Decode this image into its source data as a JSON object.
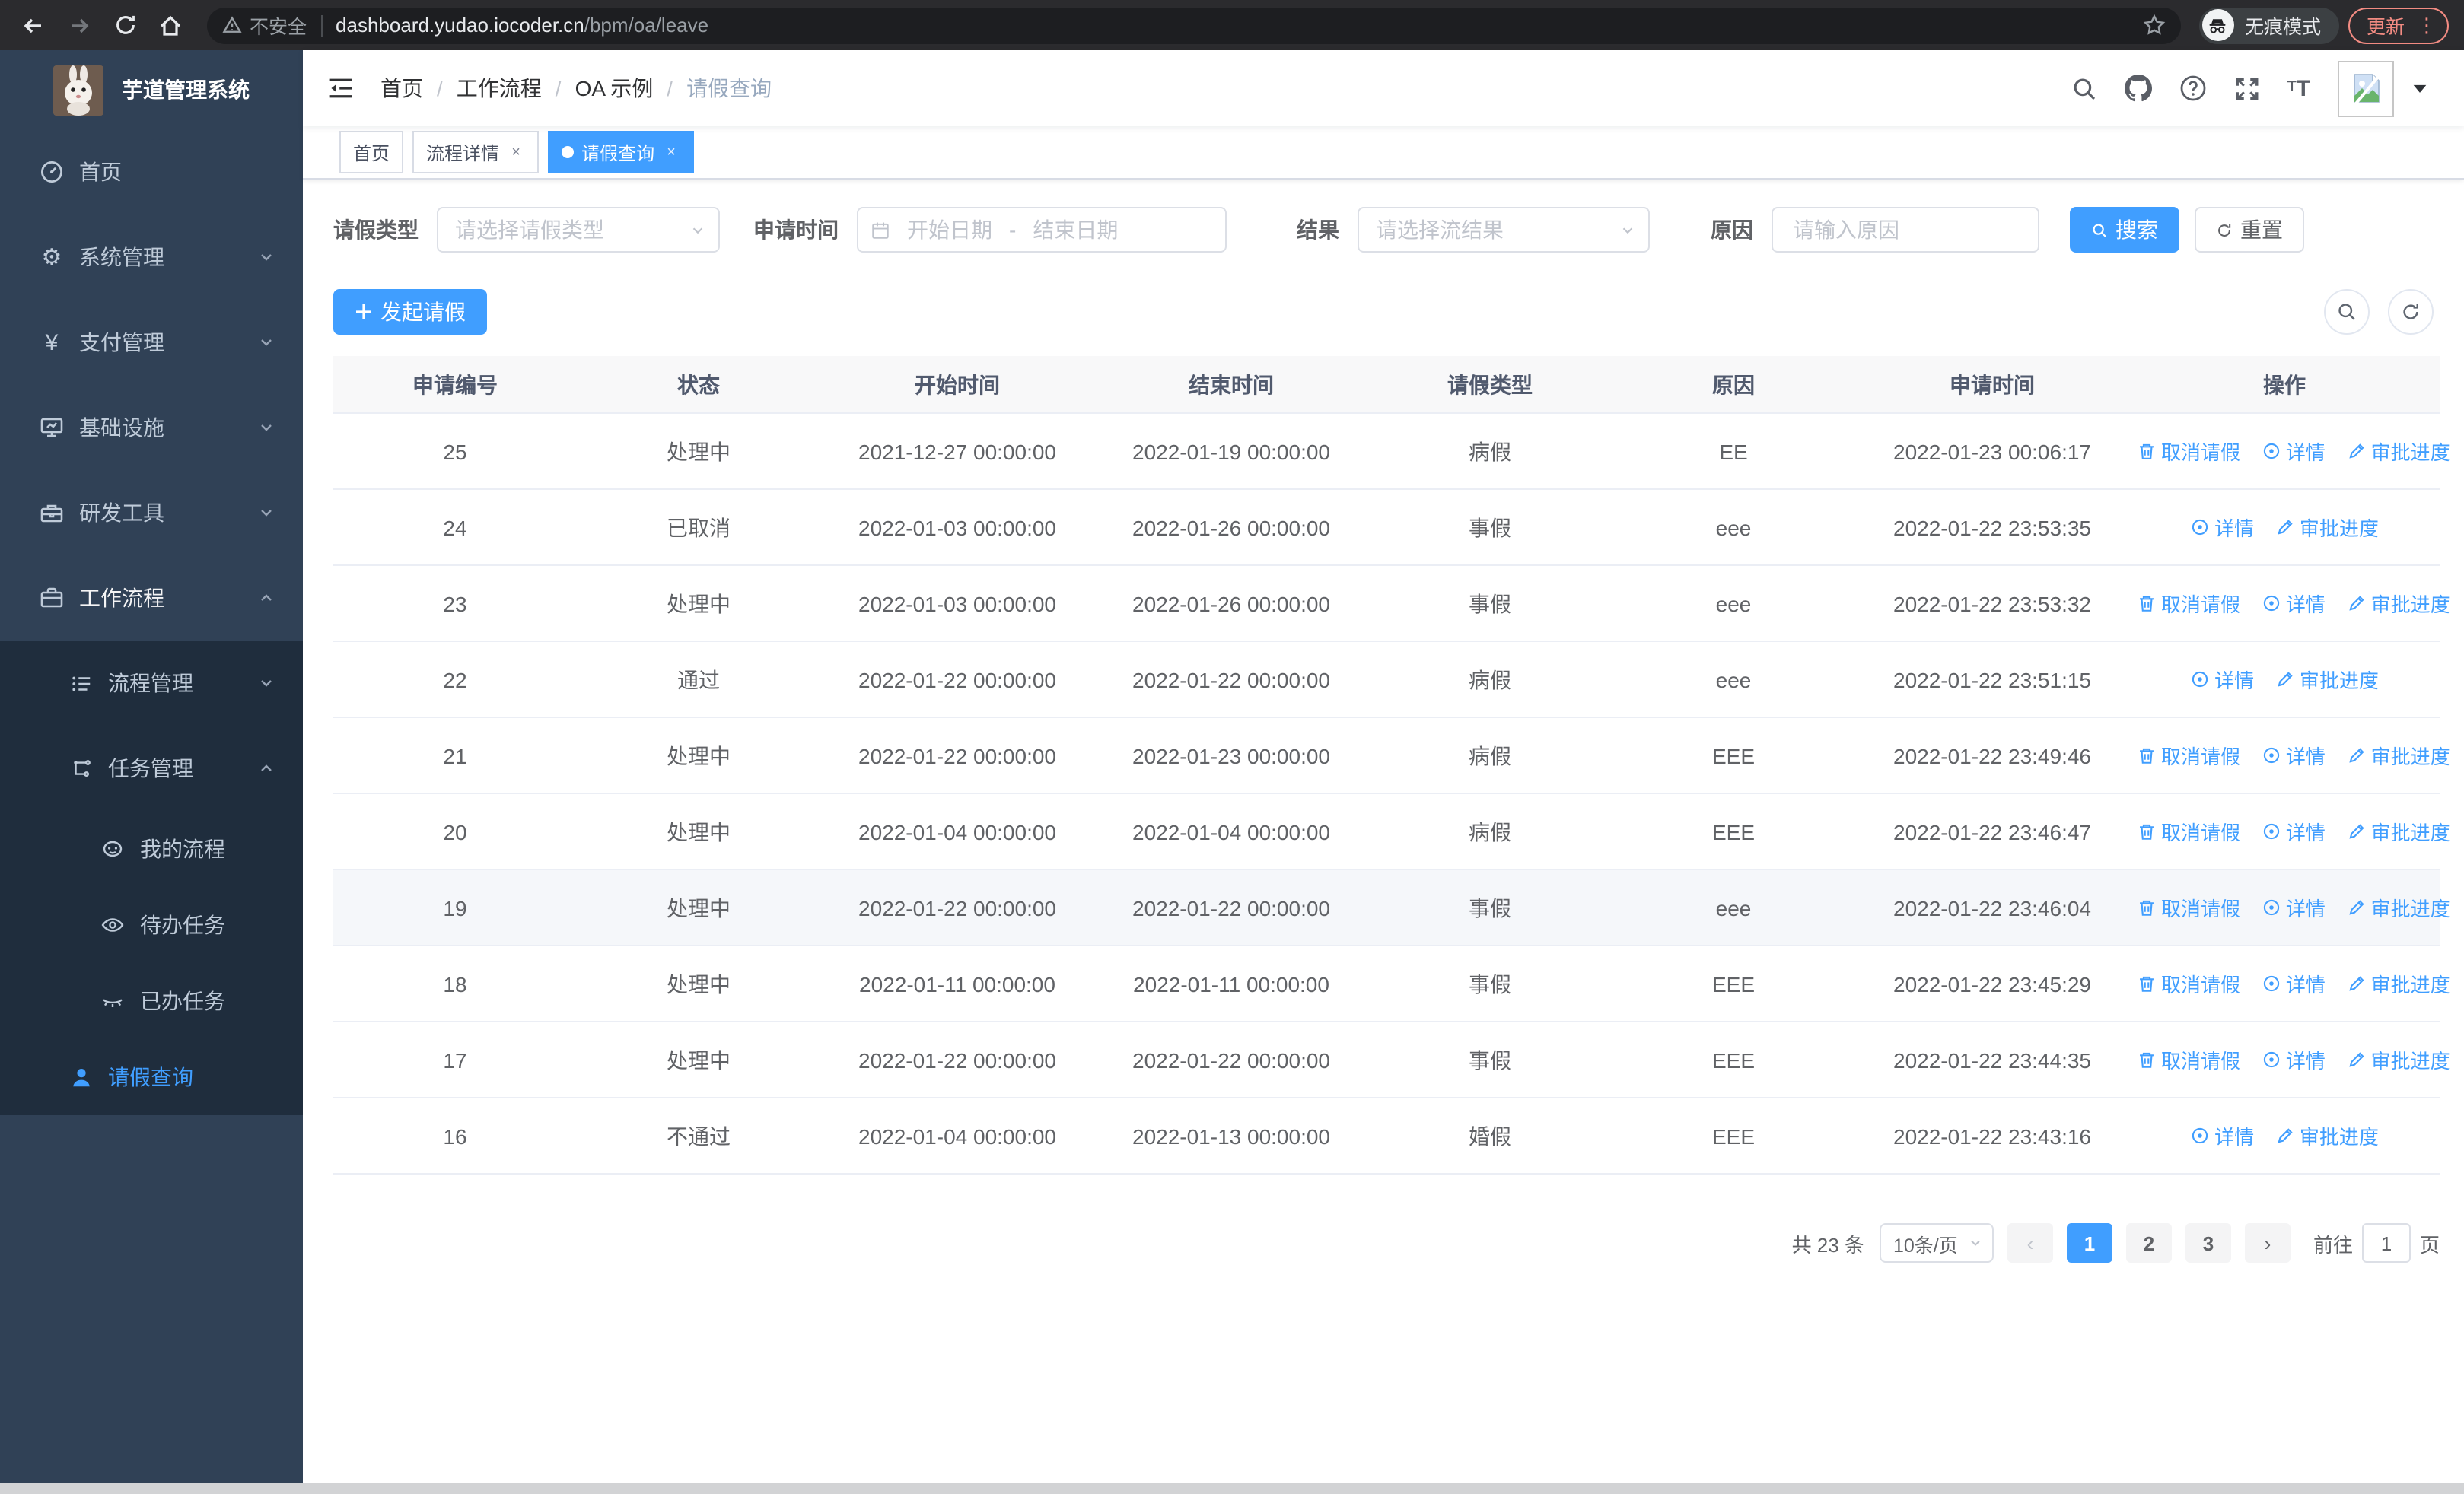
{
  "browser": {
    "security_label": "不安全",
    "url_host": "dashboard.yudao.iocoder.cn",
    "url_path": "/bpm/oa/leave",
    "incognito_label": "无痕模式",
    "update_label": "更新",
    "menu_dots": "⋮"
  },
  "sidebar": {
    "title": "芋道管理系统",
    "items": [
      {
        "label": "首页"
      },
      {
        "label": "系统管理"
      },
      {
        "label": "支付管理"
      },
      {
        "label": "基础设施"
      },
      {
        "label": "研发工具"
      },
      {
        "label": "工作流程"
      },
      {
        "label": "流程管理"
      },
      {
        "label": "任务管理"
      },
      {
        "label": "我的流程"
      },
      {
        "label": "待办任务"
      },
      {
        "label": "已办任务"
      },
      {
        "label": "请假查询"
      }
    ]
  },
  "icons": {
    "gear": "⚙",
    "yen": "¥",
    "question": "?",
    "text_size_big": "T",
    "text_size_small": "T"
  },
  "breadcrumb": [
    "首页",
    "工作流程",
    "OA 示例",
    "请假查询"
  ],
  "tabs": [
    {
      "label": "首页",
      "close": "×"
    },
    {
      "label": "流程详情",
      "close": "×"
    },
    {
      "label": "请假查询",
      "close": "×"
    }
  ],
  "filters": {
    "type_label": "请假类型",
    "type_placeholder": "请选择请假类型",
    "time_label": "申请时间",
    "time_start_placeholder": "开始日期",
    "time_separator": "-",
    "time_end_placeholder": "结束日期",
    "result_label": "结果",
    "result_placeholder": "请选择流结果",
    "reason_label": "原因",
    "reason_placeholder": "请输入原因",
    "search_label": "搜索",
    "reset_label": "重置"
  },
  "toolbar": {
    "create_label": "发起请假"
  },
  "table": {
    "columns": [
      "申请编号",
      "状态",
      "开始时间",
      "结束时间",
      "请假类型",
      "原因",
      "申请时间",
      "操作"
    ],
    "action_labels": {
      "cancel": "取消请假",
      "detail": "详情",
      "progress": "审批进度"
    },
    "rows": [
      {
        "id": "25",
        "status": "处理中",
        "start": "2021-12-27 00:00:00",
        "end": "2022-01-19 00:00:00",
        "type": "病假",
        "reason": "EE",
        "applied": "2022-01-23 00:06:17",
        "cancellable": true,
        "highlighted": false
      },
      {
        "id": "24",
        "status": "已取消",
        "start": "2022-01-03 00:00:00",
        "end": "2022-01-26 00:00:00",
        "type": "事假",
        "reason": "eee",
        "applied": "2022-01-22 23:53:35",
        "cancellable": false,
        "highlighted": false
      },
      {
        "id": "23",
        "status": "处理中",
        "start": "2022-01-03 00:00:00",
        "end": "2022-01-26 00:00:00",
        "type": "事假",
        "reason": "eee",
        "applied": "2022-01-22 23:53:32",
        "cancellable": true,
        "highlighted": false
      },
      {
        "id": "22",
        "status": "通过",
        "start": "2022-01-22 00:00:00",
        "end": "2022-01-22 00:00:00",
        "type": "病假",
        "reason": "eee",
        "applied": "2022-01-22 23:51:15",
        "cancellable": false,
        "highlighted": false
      },
      {
        "id": "21",
        "status": "处理中",
        "start": "2022-01-22 00:00:00",
        "end": "2022-01-23 00:00:00",
        "type": "病假",
        "reason": "EEE",
        "applied": "2022-01-22 23:49:46",
        "cancellable": true,
        "highlighted": false
      },
      {
        "id": "20",
        "status": "处理中",
        "start": "2022-01-04 00:00:00",
        "end": "2022-01-04 00:00:00",
        "type": "病假",
        "reason": "EEE",
        "applied": "2022-01-22 23:46:47",
        "cancellable": true,
        "highlighted": false
      },
      {
        "id": "19",
        "status": "处理中",
        "start": "2022-01-22 00:00:00",
        "end": "2022-01-22 00:00:00",
        "type": "事假",
        "reason": "eee",
        "applied": "2022-01-22 23:46:04",
        "cancellable": true,
        "highlighted": true
      },
      {
        "id": "18",
        "status": "处理中",
        "start": "2022-01-11 00:00:00",
        "end": "2022-01-11 00:00:00",
        "type": "事假",
        "reason": "EEE",
        "applied": "2022-01-22 23:45:29",
        "cancellable": true,
        "highlighted": false
      },
      {
        "id": "17",
        "status": "处理中",
        "start": "2022-01-22 00:00:00",
        "end": "2022-01-22 00:00:00",
        "type": "事假",
        "reason": "EEE",
        "applied": "2022-01-22 23:44:35",
        "cancellable": true,
        "highlighted": false
      },
      {
        "id": "16",
        "status": "不通过",
        "start": "2022-01-04 00:00:00",
        "end": "2022-01-13 00:00:00",
        "type": "婚假",
        "reason": "EEE",
        "applied": "2022-01-22 23:43:16",
        "cancellable": false,
        "highlighted": false
      }
    ]
  },
  "pagination": {
    "total_label": "共 23 条",
    "page_size": "10条/页",
    "prev": "‹",
    "next": "›",
    "pages": [
      "1",
      "2",
      "3"
    ],
    "active_page": "1",
    "goto_label": "前往",
    "goto_value": "1",
    "page_unit": "页"
  },
  "colors": {
    "accent": "#409eff",
    "sidebar_bg": "#304156",
    "submenu_bg": "#1f2d3d",
    "update_accent": "#f28b82"
  }
}
